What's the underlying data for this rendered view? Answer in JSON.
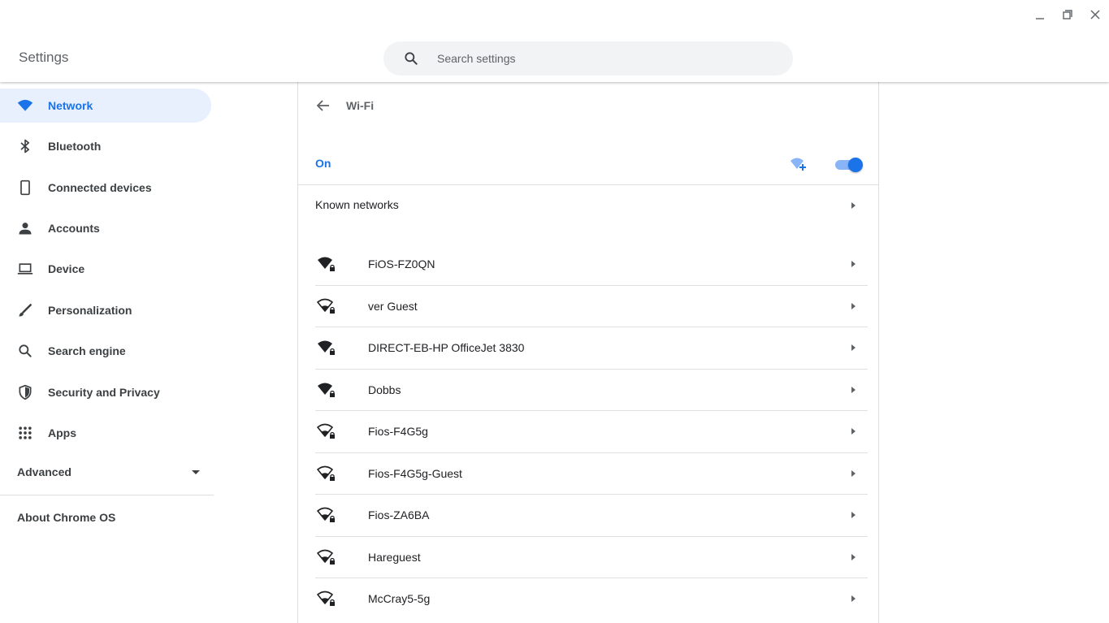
{
  "window": {
    "controls": [
      "minimize",
      "restore",
      "close"
    ]
  },
  "header": {
    "title": "Settings",
    "search_placeholder": "Search settings"
  },
  "sidebar": {
    "items": [
      {
        "label": "Network",
        "icon": "wifi-icon",
        "active": true
      },
      {
        "label": "Bluetooth",
        "icon": "bluetooth-icon",
        "active": false
      },
      {
        "label": "Connected devices",
        "icon": "phone-icon",
        "active": false
      },
      {
        "label": "Accounts",
        "icon": "person-icon",
        "active": false
      },
      {
        "label": "Device",
        "icon": "laptop-icon",
        "active": false
      },
      {
        "label": "Personalization",
        "icon": "brush-icon",
        "active": false
      },
      {
        "label": "Search engine",
        "icon": "search-icon",
        "active": false
      },
      {
        "label": "Security and Privacy",
        "icon": "shield-icon",
        "active": false
      },
      {
        "label": "Apps",
        "icon": "apps-grid-icon",
        "active": false
      }
    ],
    "advanced_label": "Advanced",
    "about_label": "About Chrome OS"
  },
  "wifi": {
    "title": "Wi-Fi",
    "state_label": "On",
    "enabled": true,
    "known_networks_label": "Known networks",
    "networks": [
      {
        "name": "FiOS-FZ0QN",
        "secured": true,
        "signal": "full"
      },
      {
        "name": "ver Guest",
        "secured": true,
        "signal": "low"
      },
      {
        "name": "DIRECT-EB-HP OfficeJet 3830",
        "secured": true,
        "signal": "full"
      },
      {
        "name": "Dobbs",
        "secured": true,
        "signal": "full"
      },
      {
        "name": "Fios-F4G5g",
        "secured": true,
        "signal": "low"
      },
      {
        "name": "Fios-F4G5g-Guest",
        "secured": true,
        "signal": "low"
      },
      {
        "name": "Fios-ZA6BA",
        "secured": true,
        "signal": "low"
      },
      {
        "name": "Hareguest",
        "secured": true,
        "signal": "low"
      },
      {
        "name": "McCray5-5g",
        "secured": true,
        "signal": "low"
      }
    ]
  },
  "colors": {
    "accent": "#1a73e8",
    "active_bg": "#e8f0fe",
    "toggle_track": "#8ab4f8",
    "text_primary": "#202124",
    "text_secondary": "#5f6368"
  }
}
